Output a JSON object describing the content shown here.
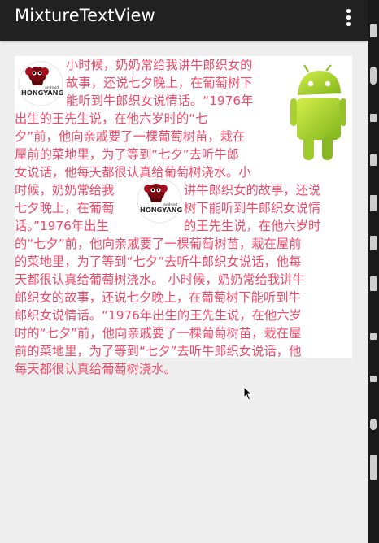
{
  "app": {
    "title": "MixtureTextView",
    "overflow_menu_icon": "overflow-menu-icon"
  },
  "colors": {
    "text": "#f04a6a",
    "actionbar": "#212121",
    "background": "#eeeeee",
    "panel": "#ffffff"
  },
  "images": {
    "logo_top": "hongyang-logo",
    "logo_mid": "hongyang-logo",
    "android": "android-robot"
  },
  "logo": {
    "brand": "HONGYANG",
    "small": "android"
  },
  "lines": [
    "小时候，奶奶常给我讲牛郎织女的",
    "故事，还说七夕晚上，在葡萄树下",
    "能听到牛郎织女说情话。“1976年",
    "出生的王先生说，在他六岁时的“七",
    "夕”前，他向亲戚要了一棵葡萄树苗，栽在",
    "屋前的菜地里，为了等到“七夕”去听牛郎",
    "女说话，他每天都很认真给葡萄树浇水。小",
    "时候，奶奶常给我",
    "讲牛郎织女的故事，还说",
    "七夕晚上，在葡萄",
    "树下能听到牛郎织女说情",
    "话。”1976年出生",
    "的王先生说，在他六岁时",
    "的“七夕”前，他向亲戚要了一棵葡萄树苗，栽在屋前",
    "的菜地里，为了等到“七夕”去听牛郎织女说话，他每",
    "天都很认真给葡萄树浇水。 小时候，奶奶常给我讲牛",
    "郎织女的故事，还说七夕晚上，在葡萄树下能听到牛",
    "郎织女说情话。“1976年出生的王先生说，在他六岁",
    "时的“七夕”前，他向亲戚要了一棵葡萄树苗，栽在屋",
    "前的菜地里，为了等到“七夕”去听牛郎织女说话，他",
    "每天都很认真给葡萄树浇水。"
  ]
}
